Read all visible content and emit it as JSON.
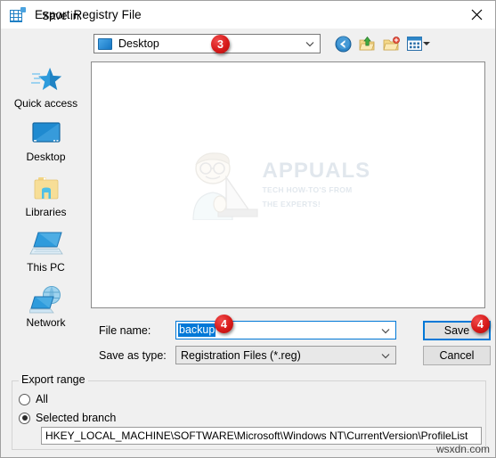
{
  "window": {
    "title": "Export Registry File",
    "title_icon": "registry-file-icon",
    "close_icon": "close-icon"
  },
  "savein": {
    "label": "Save in:",
    "value": "Desktop",
    "value_icon": "desktop-icon",
    "dropdown_icon": "chevron-down-icon",
    "badge": "3"
  },
  "toolbar": {
    "buttons": [
      {
        "name": "back-button",
        "icon": "back-arrow-icon",
        "label": "Back"
      },
      {
        "name": "up-button",
        "icon": "up-folder-icon",
        "label": "Up one level"
      },
      {
        "name": "new-folder-button",
        "icon": "new-folder-icon",
        "label": "Create New Folder"
      },
      {
        "name": "views-button",
        "icon": "views-grid-icon",
        "label": "Views"
      }
    ]
  },
  "places": [
    {
      "name": "quick-access",
      "label": "Quick access",
      "icon": "star-icon"
    },
    {
      "name": "desktop",
      "label": "Desktop",
      "icon": "monitor-icon"
    },
    {
      "name": "libraries",
      "label": "Libraries",
      "icon": "folder-icon"
    },
    {
      "name": "this-pc",
      "label": "This PC",
      "icon": "computer-icon"
    },
    {
      "name": "network",
      "label": "Network",
      "icon": "network-globe-icon"
    }
  ],
  "filelist": {
    "items": [],
    "watermark": {
      "title": "APPUALS",
      "subtitle_line1": "TECH HOW-TO'S FROM",
      "subtitle_line2": "THE EXPERTS!",
      "icon": "person-laptop-icon"
    }
  },
  "form": {
    "filename_label": "File name:",
    "filename_value": "backup",
    "filename_placeholder": "",
    "filetype_label": "Save as type:",
    "filetype_value": "Registration Files (*.reg)",
    "filename_badge": "4",
    "dropdown_icon": "chevron-down-icon"
  },
  "buttons": {
    "save": "Save",
    "cancel": "Cancel",
    "save_badge": "4"
  },
  "export_range": {
    "group_title": "Export range",
    "options": [
      {
        "name": "all",
        "label": "All",
        "selected": false
      },
      {
        "name": "selected-branch",
        "label": "Selected branch",
        "selected": true
      }
    ],
    "branch_value": "HKEY_LOCAL_MACHINE\\SOFTWARE\\Microsoft\\Windows NT\\CurrentVersion\\ProfileList"
  },
  "site_watermark": "wsxdn.com",
  "colors": {
    "accent": "#0078d7",
    "badge_red": "#d71a1a",
    "window_bg": "#f0f0f0"
  }
}
